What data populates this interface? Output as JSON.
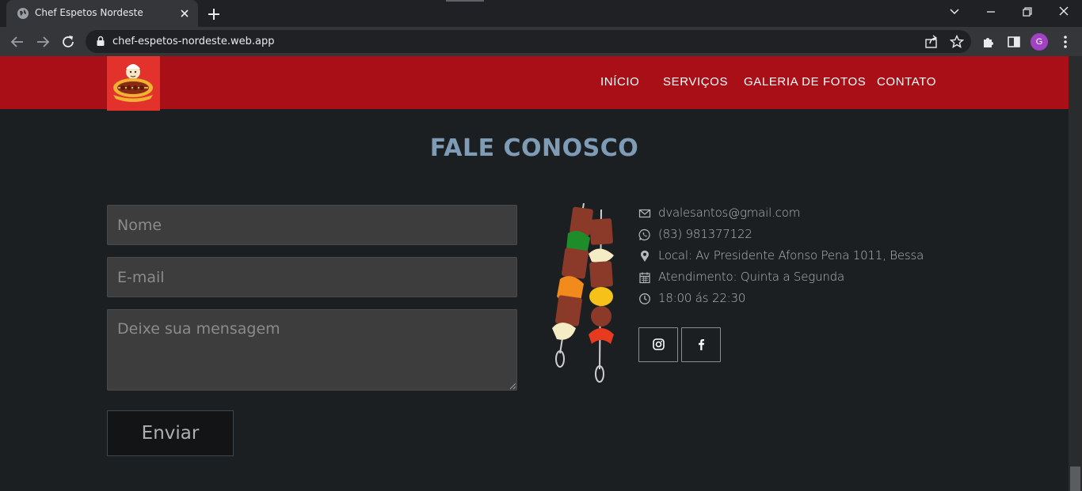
{
  "browser": {
    "tab_title": "Chef Espetos Nordeste",
    "url": "chef-espetos-nordeste.web.app",
    "profile_initial": "G"
  },
  "nav": {
    "items": [
      "INÍCIO",
      "SERVIÇOS",
      "GALERIA DE FOTOS",
      "CONTATO"
    ]
  },
  "contact": {
    "title": "FALE CONOSCO",
    "form": {
      "name_placeholder": "Nome",
      "email_placeholder": "E-mail",
      "message_placeholder": "Deixe sua mensagem",
      "submit_label": "Enviar"
    },
    "info": {
      "email": "dvalesantos@gmail.com",
      "phone": "(83) 981377122",
      "location": "Local: Av Presidente Afonso Pena 1011, Bessa",
      "schedule": "Atendimento: Quinta a Segunda",
      "hours": "18:00 ás 22:30"
    },
    "social": [
      "instagram-icon",
      "facebook-icon"
    ]
  },
  "colors": {
    "header_red": "#a80f17",
    "page_bg": "#1c1f21",
    "title_blue": "#7f9cb7"
  }
}
